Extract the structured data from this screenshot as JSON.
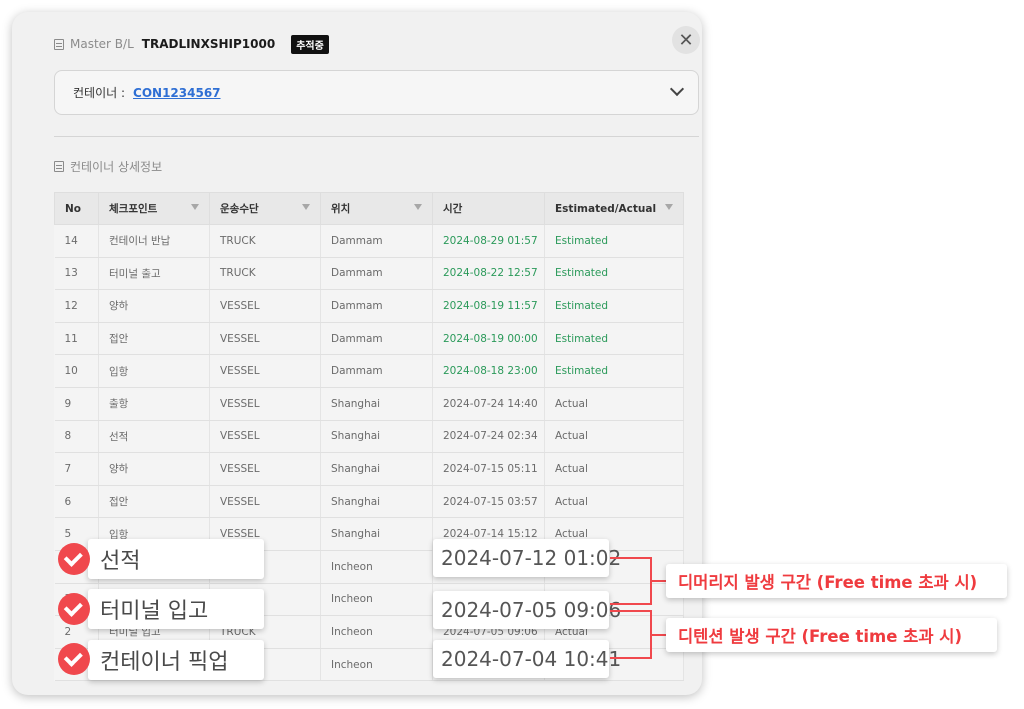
{
  "header": {
    "mbl_label": "Master B/L",
    "mbl_value": "TRADLINXSHIP1000",
    "status_badge": "추적중",
    "close_label": "✕"
  },
  "container_select": {
    "label": "컨테이너 :",
    "value": "CON1234567"
  },
  "section_title": "컨테이너 상세정보",
  "table": {
    "columns": [
      "No",
      "체크포인트",
      "운송수단",
      "위치",
      "시간",
      "Estimated/Actual"
    ],
    "rows": [
      [
        "14",
        "컨테이너 반납",
        "TRUCK",
        "Dammam",
        "2024-08-29 01:57",
        "Estimated"
      ],
      [
        "13",
        "터미널 출고",
        "TRUCK",
        "Dammam",
        "2024-08-22 12:57",
        "Estimated"
      ],
      [
        "12",
        "양하",
        "VESSEL",
        "Dammam",
        "2024-08-19 11:57",
        "Estimated"
      ],
      [
        "11",
        "접안",
        "VESSEL",
        "Dammam",
        "2024-08-19 00:00",
        "Estimated"
      ],
      [
        "10",
        "입항",
        "VESSEL",
        "Dammam",
        "2024-08-18 23:00",
        "Estimated"
      ],
      [
        "9",
        "출항",
        "VESSEL",
        "Shanghai",
        "2024-07-24 14:40",
        "Actual"
      ],
      [
        "8",
        "선적",
        "VESSEL",
        "Shanghai",
        "2024-07-24 02:34",
        "Actual"
      ],
      [
        "7",
        "양하",
        "VESSEL",
        "Shanghai",
        "2024-07-15 05:11",
        "Actual"
      ],
      [
        "6",
        "접안",
        "VESSEL",
        "Shanghai",
        "2024-07-15 03:57",
        "Actual"
      ],
      [
        "5",
        "입항",
        "VESSEL",
        "Shanghai",
        "2024-07-14 15:12",
        "Actual"
      ],
      [
        "4",
        "",
        "",
        "Incheon",
        "",
        ""
      ],
      [
        "3",
        "",
        "",
        "Incheon",
        "",
        ""
      ],
      [
        "2",
        "터미널 입고",
        "TRUCK",
        "Incheon",
        "2024-07-05 09:06",
        "Actual"
      ],
      [
        "1",
        "",
        "",
        "Incheon",
        "",
        ""
      ]
    ]
  },
  "highlights": {
    "checkpoints": [
      "선적",
      "터미널 입고",
      "컨테이너 픽업"
    ],
    "times": [
      "2024-07-12 01:02",
      "2024-07-05 09:06",
      "2024-07-04 10:41"
    ],
    "callouts": [
      "디머리지 발생 구간 (Free time 초과 시)",
      "디텐션 발생 구간 (Free time 초과 시)"
    ]
  },
  "colors": {
    "estimated": "#2b9a5a",
    "highlight_red": "#f0484d",
    "link_blue": "#2f6fd4"
  }
}
